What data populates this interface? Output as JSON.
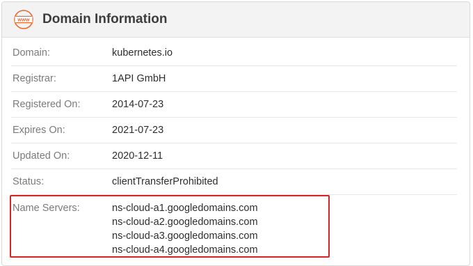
{
  "header": {
    "icon": "www-globe-icon",
    "icon_text": "www",
    "title": "Domain Information",
    "accent": "#e8692e"
  },
  "rows": [
    {
      "label": "Domain:",
      "value": "kubernetes.io"
    },
    {
      "label": "Registrar:",
      "value": "1API GmbH"
    },
    {
      "label": "Registered On:",
      "value": "2014-07-23"
    },
    {
      "label": "Expires On:",
      "value": "2021-07-23"
    },
    {
      "label": "Updated On:",
      "value": "2020-12-11"
    },
    {
      "label": "Status:",
      "value": "clientTransferProhibited"
    }
  ],
  "name_servers": {
    "label": "Name Servers:",
    "values": [
      "ns-cloud-a1.googledomains.com",
      "ns-cloud-a2.googledomains.com",
      "ns-cloud-a3.googledomains.com",
      "ns-cloud-a4.googledomains.com"
    ]
  },
  "highlight_color": "#d42424"
}
